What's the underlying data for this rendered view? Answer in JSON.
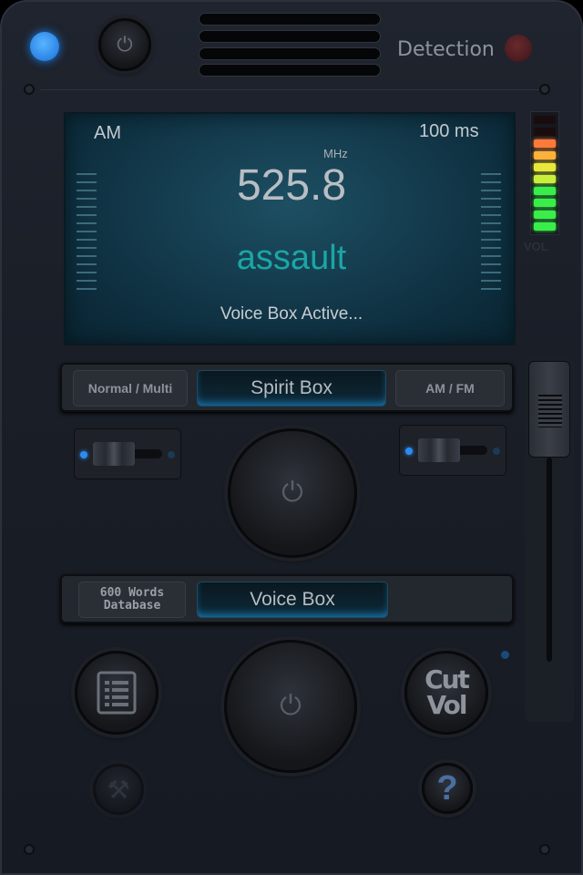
{
  "header": {
    "detection_label": "Detection",
    "power_led_color": "#2a8cf0",
    "detection_led_color": "#5a2226"
  },
  "display": {
    "band": "AM",
    "sweep_rate": "100 ms",
    "frequency_unit": "MHz",
    "frequency": "525.8",
    "word": "assault",
    "status": "Voice Box Active...",
    "word_color": "#1aa6a6"
  },
  "vu_meter": {
    "label": "VOL",
    "segments_total": 10,
    "segments_lit": 8
  },
  "mode_bar": {
    "left_label": "Normal / Multi",
    "center_label": "Spirit Box",
    "right_label": "AM / FM"
  },
  "voice_bar": {
    "left_label": "600 Words Database",
    "center_label": "Voice Box"
  },
  "buttons": {
    "cut_vol_line1": "Cut",
    "cut_vol_line2": "Vol",
    "help": "?"
  },
  "volume_slider": {
    "level": 1.0
  }
}
